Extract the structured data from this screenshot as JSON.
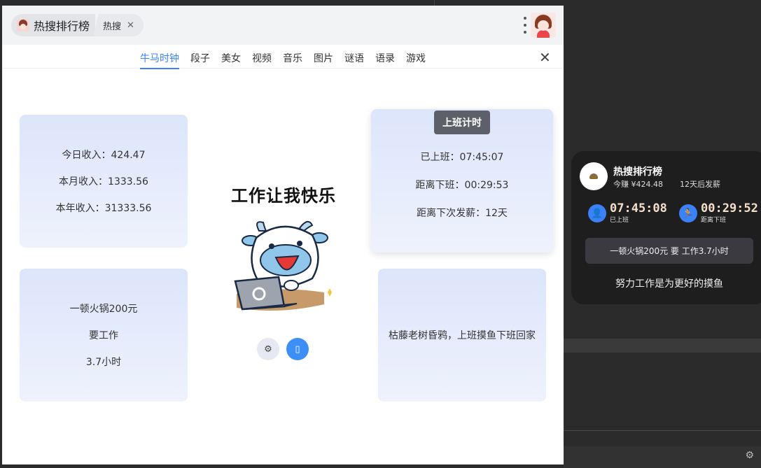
{
  "window": {
    "app_title": "热搜排行榜",
    "sub_tab_label": "热搜",
    "close_glyph": "✕"
  },
  "nav": {
    "items": [
      "牛马时钟",
      "段子",
      "美女",
      "视频",
      "音乐",
      "图片",
      "谜语",
      "语录",
      "游戏"
    ],
    "active_index": 0,
    "close_glyph": "✕"
  },
  "income": {
    "today": "今日收入：424.47",
    "month": "本月收入：1333.56",
    "year": "本年收入：31333.56"
  },
  "hotpot": {
    "line1": "一顿火锅200元",
    "line2": "要工作",
    "line3": "3.7小时"
  },
  "timer": {
    "badge": "上班计时",
    "worked": "已上班：07:45:07",
    "off_work": "距离下班：00:29:53",
    "payday": "距离下次发薪：12天"
  },
  "quote": {
    "text": "枯藤老树昏鸦，上班摸鱼下班回家"
  },
  "center": {
    "title": "工作让我快乐",
    "settings_icon": "gear-icon",
    "mobile_icon": "mobile-icon"
  },
  "widget": {
    "title": "热搜排行榜",
    "earn": "今赚 ¥424.48",
    "payday": "12天后发薪",
    "worked_time": "07:45:08",
    "worked_caption": "已上班",
    "remain_time": "00:29:52",
    "remain_caption": "距离下班",
    "pill": "一顿火锅200元 要 工作3.7小时",
    "slogan": "努力工作是为更好的摸鱼"
  },
  "colors": {
    "accent": "#3b82f6",
    "card_bg": "#dde5fb",
    "widget_bg": "#1e1e1e"
  }
}
